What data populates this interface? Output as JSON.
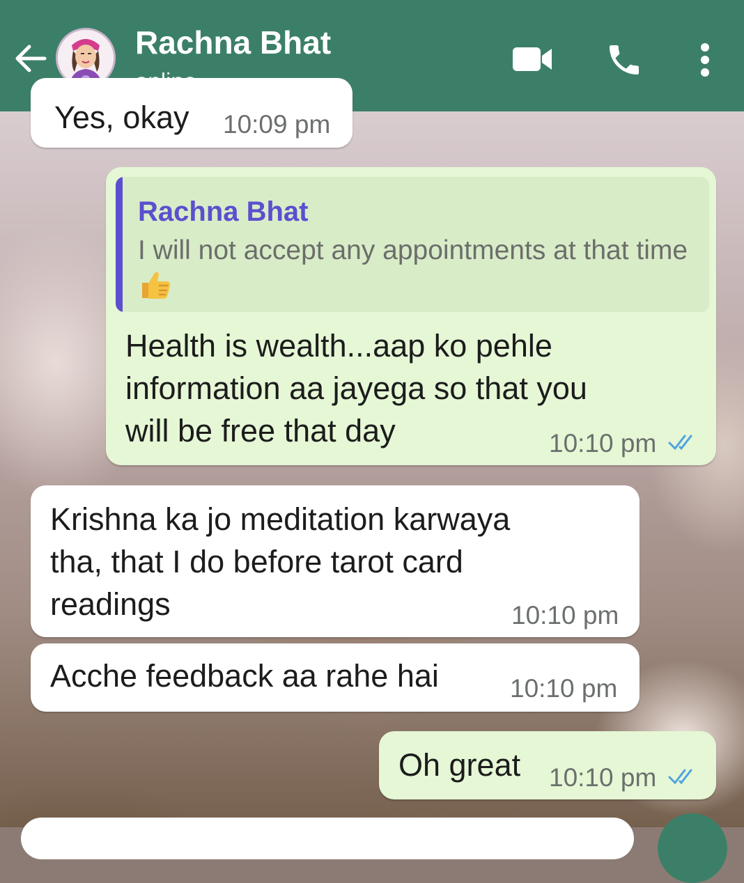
{
  "header": {
    "contact_name": "Rachna Bhat",
    "status": "online"
  },
  "messages": [
    {
      "direction": "in",
      "text": "Yes, okay",
      "time": "10:09 pm"
    },
    {
      "direction": "out",
      "quote": {
        "author": "Rachna Bhat",
        "text": "I will not accept any appointments at that time"
      },
      "text": "Health is wealth...aap ko pehle\ninformation aa jayega so that you\nwill be free that day",
      "time": "10:10 pm",
      "read": true
    },
    {
      "direction": "in",
      "text": "Krishna ka jo meditation karwaya\ntha, that I do before tarot card\nreadings",
      "time": "10:10 pm"
    },
    {
      "direction": "in",
      "text": "Acche feedback aa rahe hai",
      "time": "10:10 pm"
    },
    {
      "direction": "out",
      "text": "Oh great",
      "time": "10:10 pm",
      "read": true
    }
  ],
  "colors": {
    "header": "#3c7f69",
    "outgoing_bubble": "#e5f7d5",
    "incoming_bubble": "#ffffff",
    "quote_accent": "#5b4fcf",
    "read_ticks": "#4fa3e0"
  },
  "icons": {
    "back": "arrow-left-icon",
    "video": "video-camera-icon",
    "call": "phone-icon",
    "menu": "more-vertical-icon",
    "read_receipt": "double-check-icon",
    "emoji": "thumbs-up-emoji"
  }
}
